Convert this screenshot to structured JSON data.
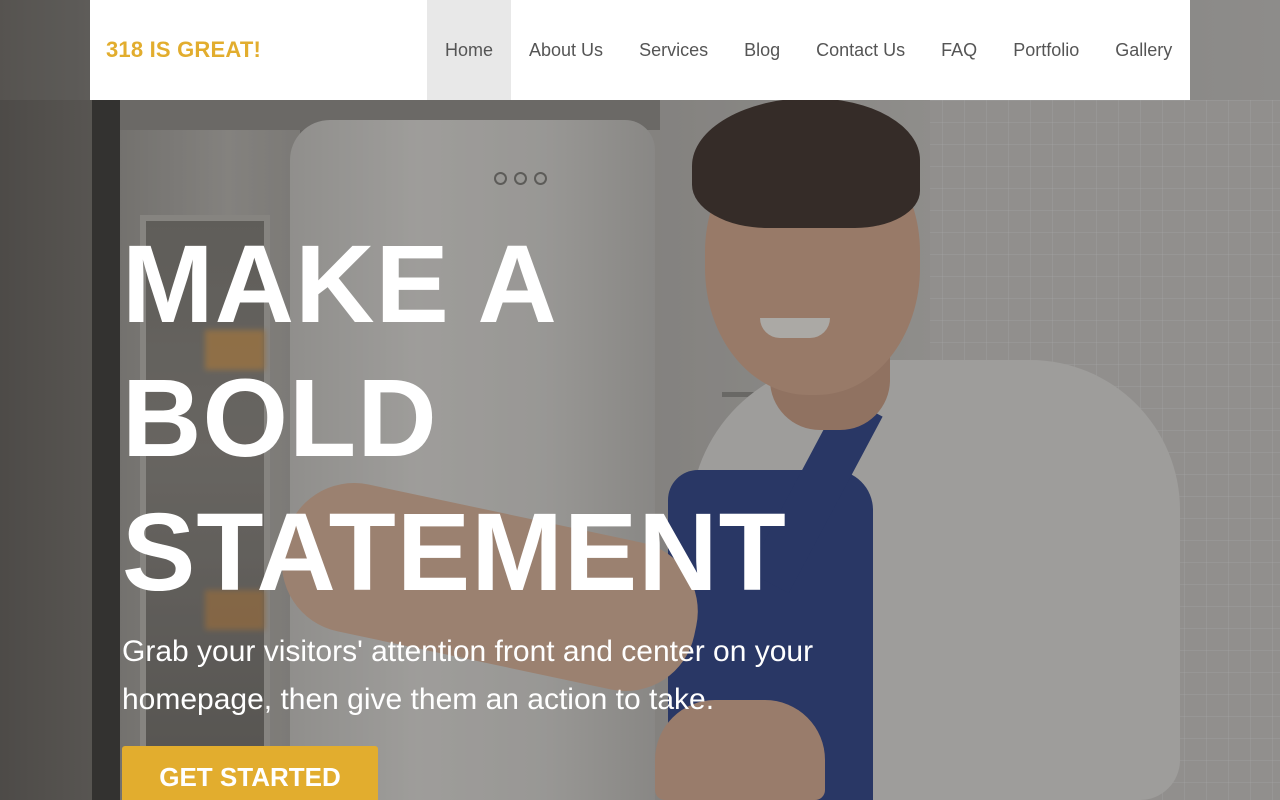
{
  "header": {
    "logo": "318 IS GREAT!",
    "nav": [
      {
        "label": "Home",
        "active": true
      },
      {
        "label": "About Us",
        "active": false
      },
      {
        "label": "Services",
        "active": false
      },
      {
        "label": "Blog",
        "active": false
      },
      {
        "label": "Contact Us",
        "active": false
      },
      {
        "label": "FAQ",
        "active": false
      },
      {
        "label": "Portfolio",
        "active": false
      },
      {
        "label": "Gallery",
        "active": false
      }
    ]
  },
  "hero": {
    "headline_lines": [
      "MAKE A",
      "BOLD",
      "STATEMENT"
    ],
    "subtext": "Grab your visitors' attention front and center on your homepage, then give them an action to take.",
    "cta_label": "GET STARTED",
    "image_description_icon": "technician-photo"
  },
  "colors": {
    "accent": "#e2ad2e",
    "nav_text": "#555555",
    "nav_active_bg": "#e8e8e8",
    "header_bg": "#ffffff",
    "hero_text": "#ffffff"
  }
}
